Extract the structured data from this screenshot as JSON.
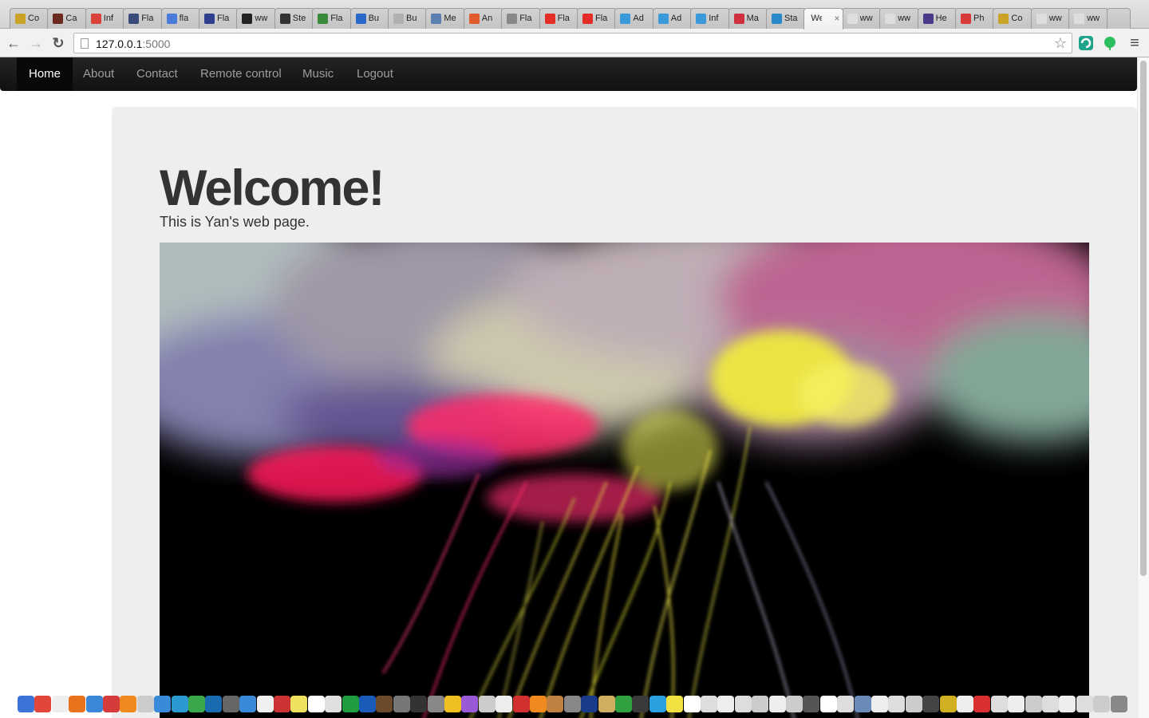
{
  "browser": {
    "tabs": [
      {
        "title": "Co",
        "fav": "#c9a227"
      },
      {
        "title": "Ca",
        "fav": "#6b2a1e"
      },
      {
        "title": "Inf",
        "fav": "#d9413a"
      },
      {
        "title": "Fla",
        "fav": "#3a4a7a"
      },
      {
        "title": "fla",
        "fav": "#4a7bd8"
      },
      {
        "title": "Fla",
        "fav": "#2f3f8f"
      },
      {
        "title": "ww",
        "fav": "#222222"
      },
      {
        "title": "Ste",
        "fav": "#333333"
      },
      {
        "title": "Fla",
        "fav": "#3b8a3b"
      },
      {
        "title": "Bu",
        "fav": "#2a68c9"
      },
      {
        "title": "Bu",
        "fav": "#b0b0b0"
      },
      {
        "title": "Me",
        "fav": "#5a7fb0"
      },
      {
        "title": "An",
        "fav": "#e15b2c"
      },
      {
        "title": "Fla",
        "fav": "#888888"
      },
      {
        "title": "Fla",
        "fav": "#e52d27"
      },
      {
        "title": "Fla",
        "fav": "#e52d27"
      },
      {
        "title": "Ad",
        "fav": "#3a9ad9"
      },
      {
        "title": "Ad",
        "fav": "#3a9ad9"
      },
      {
        "title": "Inf",
        "fav": "#3a9ad9"
      },
      {
        "title": "Ma",
        "fav": "#d02f3d"
      },
      {
        "title": "Sta",
        "fav": "#2a8ac9"
      },
      {
        "title": "We",
        "fav": "",
        "active": true
      },
      {
        "title": "ww",
        "fav": "#dddddd"
      },
      {
        "title": "ww",
        "fav": "#dddddd"
      },
      {
        "title": "He",
        "fav": "#4b3a8a"
      },
      {
        "title": "Ph",
        "fav": "#d83a3a"
      },
      {
        "title": "Co",
        "fav": "#c9a227"
      },
      {
        "title": "ww",
        "fav": "#dddddd"
      },
      {
        "title": "ww",
        "fav": "#dddddd"
      }
    ],
    "url_host": "127.0.0.1",
    "url_port": ":5000",
    "back_icon": "←",
    "forward_icon": "→",
    "reload_icon": "↻",
    "star_icon": "☆",
    "menu_icon": "≡"
  },
  "site": {
    "nav": [
      {
        "label": "Home",
        "active": true
      },
      {
        "label": "About"
      },
      {
        "label": "Contact"
      },
      {
        "label": "Remote control"
      },
      {
        "label": "Music"
      },
      {
        "label": "Logout"
      }
    ],
    "heading": "Welcome!",
    "subheading": "This is Yan's web page."
  },
  "dock": {
    "colors": [
      "#3b73d6",
      "#e0463a",
      "#eeeeee",
      "#e8731c",
      "#3b88d8",
      "#d63b3b",
      "#f08a1e",
      "#cccccc",
      "#3a8ad9",
      "#2a9ad0",
      "#3aa84a",
      "#1a6ab0",
      "#666666",
      "#3a8ad9",
      "#f0f0f0",
      "#cc3333",
      "#f0e060",
      "#ffffff",
      "#e0e0e0",
      "#1e9e3e",
      "#1a5ab8",
      "#6a4a2a",
      "#777777",
      "#333333",
      "#888888",
      "#f0c020",
      "#9a5ad8",
      "#cccccc",
      "#eeeeee",
      "#d03030",
      "#f08a1e",
      "#c08040",
      "#888888",
      "#1a3a8a",
      "#d0b060",
      "#30a040",
      "#3a3a3a",
      "#2aa0e0",
      "#f0e040",
      "#ffffff",
      "#dddddd",
      "#eeeeee",
      "#dddddd",
      "#cccccc",
      "#eeeeee",
      "#cccccc",
      "#555555",
      "#ffffff",
      "#dddddd",
      "#6a8ab8",
      "#eeeeee",
      "#dddddd",
      "#cccccc",
      "#444444",
      "#d0b020",
      "#eeeeee",
      "#d83030",
      "#dddddd",
      "#eeeeee",
      "#cccccc",
      "#dddddd",
      "#eeeeee",
      "#dddddd",
      "#cccccc",
      "#888888"
    ]
  }
}
